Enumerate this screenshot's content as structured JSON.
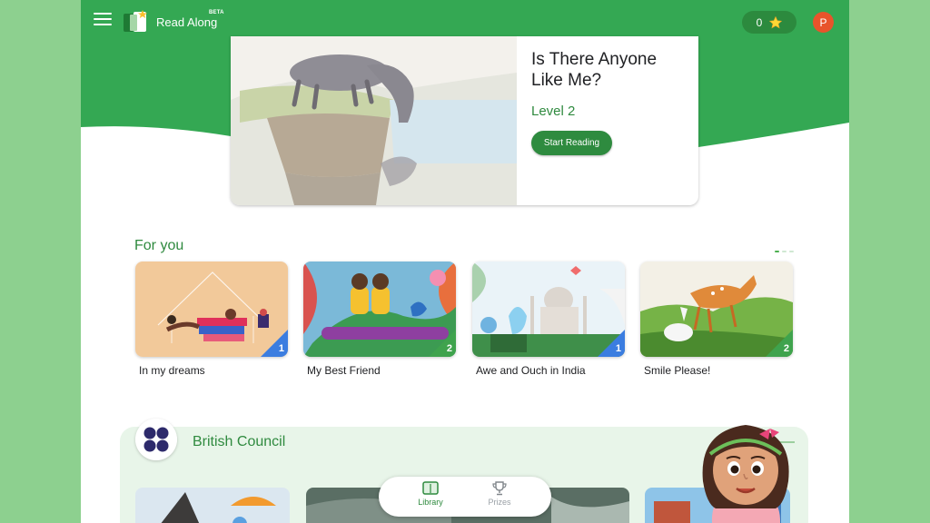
{
  "app": {
    "title": "Read Along",
    "beta": "BETA",
    "score": "0",
    "avatar_initial": "P"
  },
  "colors": {
    "brand_green": "#34a853",
    "dark_green": "#2e8b3f",
    "page_bg": "#8dd08f",
    "level1_badge": "#3b7de0",
    "level2_badge": "#3fa34d",
    "avatar": "#e8542b"
  },
  "featured": {
    "title": "Is There Anyone Like Me?",
    "level": "Level 2",
    "button_label": "Start Reading"
  },
  "for_you": {
    "title": "For you",
    "books": [
      {
        "title": "In my dreams",
        "level": "1"
      },
      {
        "title": "My Best Friend",
        "level": "2"
      },
      {
        "title": "Awe and Ouch in India",
        "level": "1"
      },
      {
        "title": "Smile Please!",
        "level": "2"
      }
    ]
  },
  "british_council": {
    "title": "British Council"
  },
  "bottom_nav": {
    "library": "Library",
    "prizes": "Prizes"
  },
  "icons": [
    "menu-icon",
    "book-logo-icon",
    "star-icon",
    "library-book-icon",
    "trophy-icon"
  ]
}
